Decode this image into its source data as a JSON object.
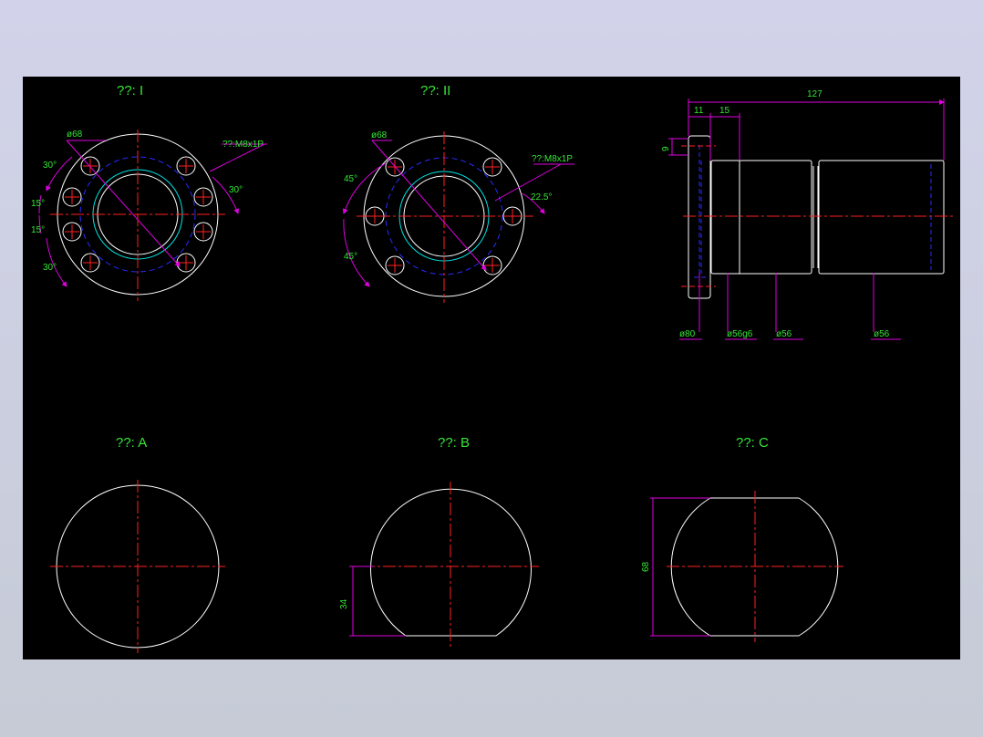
{
  "colors": {
    "background": "#000000",
    "outline": "#ffffff",
    "centerline": "#ff2020",
    "hidden": "#2b2bff",
    "dimension": "#e000e0",
    "text": "#35e635",
    "cyan": "#00e5e5"
  },
  "views": {
    "view_1_title": "??: I",
    "view_2_title": "??: II",
    "view_a_title": "??: A",
    "view_b_title": "??: B",
    "view_c_title": "??: C"
  },
  "view1": {
    "diameter": "ø68",
    "thread": "??:M8x1P",
    "angle_top_left": "30°",
    "angle_left_upper": "15°",
    "angle_left_lower": "15°",
    "angle_bottom_left": "30°",
    "angle_right": "30°"
  },
  "view2": {
    "diameter": "ø68",
    "thread": "??:M8x1P",
    "angle_upper": "45°",
    "angle_lower": "45°",
    "angle_right": "22.5°"
  },
  "side": {
    "overall_length": "127",
    "flange_width": "11",
    "step_width": "15",
    "small_dim": "9",
    "dia_flange": "ø80",
    "dia_body": "ø56g6",
    "dia_mid": "ø56",
    "dia_end": "ø56"
  },
  "viewB": {
    "dim": "34"
  },
  "viewC": {
    "dim": "68"
  }
}
